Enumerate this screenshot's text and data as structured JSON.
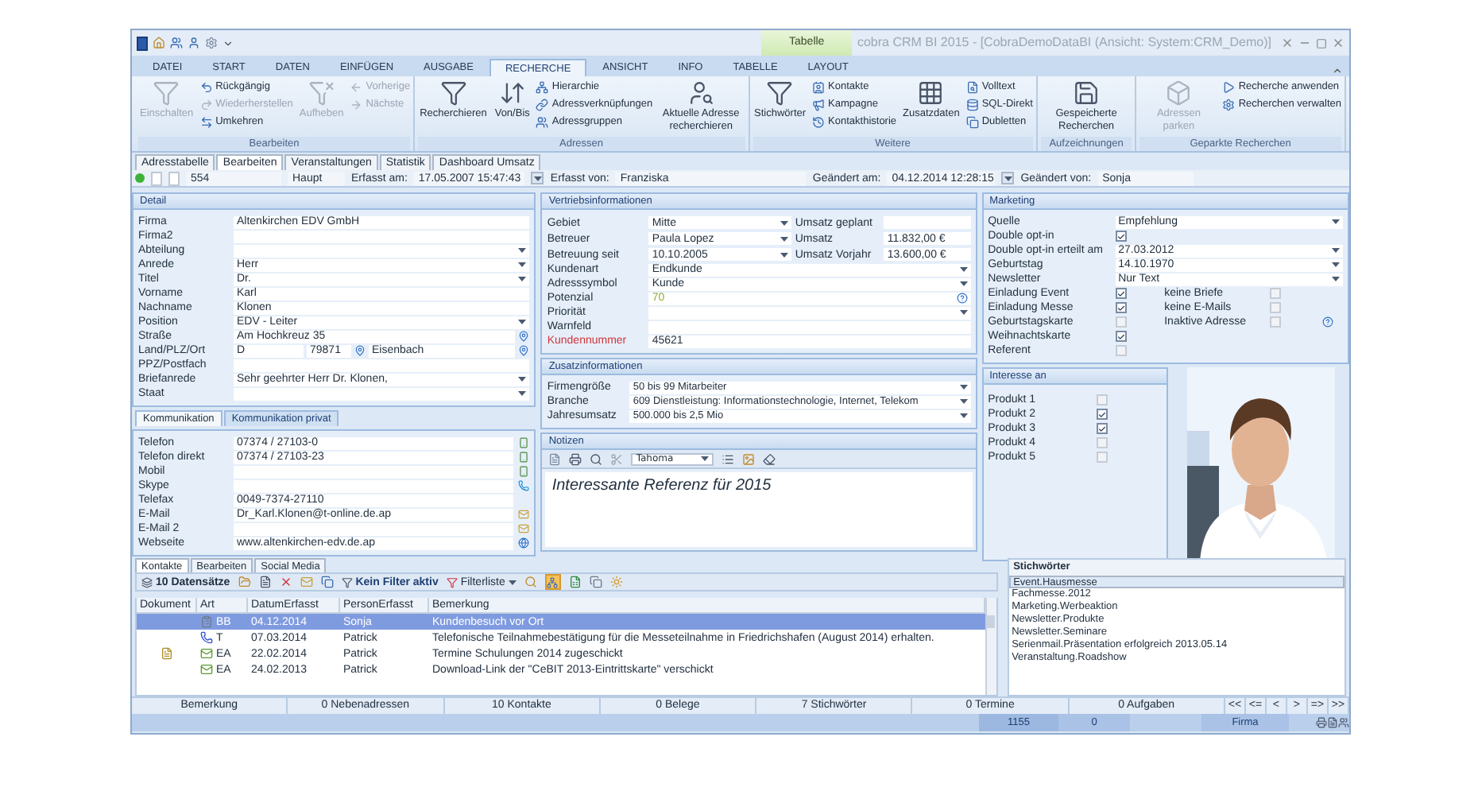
{
  "window": {
    "title": "cobra CRM BI 2015 - [CobraDemoDataBI (Ansicht: System:CRM_Demo)]",
    "context_tab": "Tabelle"
  },
  "ribbon_tabs": [
    {
      "label": "DATEI",
      "selected": false
    },
    {
      "label": "START",
      "selected": false
    },
    {
      "label": "DATEN",
      "selected": false
    },
    {
      "label": "EINFÜGEN",
      "selected": false
    },
    {
      "label": "AUSGABE",
      "selected": false
    },
    {
      "label": "RECHERCHE",
      "selected": true
    },
    {
      "label": "ANSICHT",
      "selected": false
    },
    {
      "label": "INFO",
      "selected": false
    },
    {
      "label": "TABELLE",
      "selected": false
    },
    {
      "label": "LAYOUT",
      "selected": false
    }
  ],
  "ribbon_groups": [
    {
      "title": "Bearbeiten",
      "columns": [
        {
          "kind": "large",
          "items": [
            {
              "label": "Einschalten",
              "disabled": true
            }
          ]
        },
        {
          "kind": "stack",
          "items": [
            {
              "label": "Rückgängig",
              "disabled": false
            },
            {
              "label": "Wiederherstellen",
              "disabled": true
            },
            {
              "label": "Umkehren",
              "disabled": false
            }
          ]
        },
        {
          "kind": "large",
          "items": [
            {
              "label": "Aufheben",
              "disabled": true
            }
          ]
        },
        {
          "kind": "stack",
          "items": [
            {
              "label": "Vorherige",
              "disabled": true
            },
            {
              "label": "Nächste",
              "disabled": true
            }
          ]
        }
      ]
    },
    {
      "title": "Adressen",
      "columns": [
        {
          "kind": "large",
          "items": [
            {
              "label": "Recherchieren",
              "disabled": false
            }
          ]
        },
        {
          "kind": "large",
          "items": [
            {
              "label": "Von/Bis",
              "disabled": false
            }
          ]
        },
        {
          "kind": "stack",
          "items": [
            {
              "label": "Hierarchie",
              "disabled": false
            },
            {
              "label": "Adressverknüpfungen",
              "disabled": false
            },
            {
              "label": "Adressgruppen",
              "disabled": false
            }
          ]
        },
        {
          "kind": "large",
          "items": [
            {
              "label": "Aktuelle Adresse recherchieren",
              "disabled": false
            }
          ]
        }
      ]
    },
    {
      "title": "Weitere",
      "columns": [
        {
          "kind": "large",
          "items": [
            {
              "label": "Stichwörter",
              "disabled": false
            }
          ]
        },
        {
          "kind": "stack",
          "items": [
            {
              "label": "Kontakte",
              "disabled": false
            },
            {
              "label": "Kampagne",
              "disabled": false
            },
            {
              "label": "Kontakthistorie",
              "disabled": false
            }
          ]
        },
        {
          "kind": "large",
          "items": [
            {
              "label": "Zusatzdaten",
              "disabled": false
            }
          ]
        },
        {
          "kind": "stack",
          "items": [
            {
              "label": "Volltext",
              "disabled": false
            },
            {
              "label": "SQL-Direkt",
              "disabled": false
            },
            {
              "label": "Dubletten",
              "disabled": false
            }
          ]
        }
      ]
    },
    {
      "title": "Aufzeichnungen",
      "columns": [
        {
          "kind": "large",
          "items": [
            {
              "label": "Gespeicherte Recherchen",
              "disabled": false
            }
          ]
        }
      ]
    },
    {
      "title": "Geparkte Recherchen",
      "columns": [
        {
          "kind": "large",
          "items": [
            {
              "label": "Adressen parken",
              "disabled": true
            }
          ]
        },
        {
          "kind": "stack",
          "items": [
            {
              "label": "Recherche anwenden",
              "disabled": false
            },
            {
              "label": "Recherchen verwalten",
              "disabled": false
            }
          ]
        }
      ]
    }
  ],
  "doc_tabs": [
    {
      "label": "Adresstabelle",
      "selected": false
    },
    {
      "label": "Bearbeiten",
      "selected": true
    },
    {
      "label": "Veranstaltungen",
      "selected": false
    },
    {
      "label": "Statistik",
      "selected": false
    },
    {
      "label": "Dashboard Umsatz",
      "selected": false
    }
  ],
  "record": {
    "id": "554",
    "type": "Haupt",
    "created_label": "Erfasst am:",
    "created": "17.05.2007 15:47:43",
    "creator_label": "Erfasst von:",
    "creator": "Franziska",
    "changed_label": "Geändert am:",
    "changed": "04.12.2014 12:28:15",
    "changer_label": "Geändert von:",
    "changer": "Sonja"
  },
  "detail": {
    "title": "Detail",
    "fields": [
      {
        "label": "Firma",
        "value": "Altenkirchen EDV GmbH",
        "kind": "text"
      },
      {
        "label": "Firma2",
        "kind": "text"
      },
      {
        "label": "Abteilung",
        "kind": "dropdown"
      },
      {
        "label": "Anrede",
        "value": "Herr",
        "kind": "dropdown"
      },
      {
        "label": "Titel",
        "value": "Dr.",
        "kind": "dropdown"
      },
      {
        "label": "Vorname",
        "value": "Karl",
        "kind": "text"
      },
      {
        "label": "Nachname",
        "value": "Klonen",
        "kind": "text"
      },
      {
        "label": "Position",
        "value": "EDV - Leiter",
        "kind": "dropdown"
      },
      {
        "label": "Straße",
        "value": "Am Hochkreuz 35",
        "kind": "pin"
      },
      {
        "label": "Land/PLZ/Ort",
        "value": "D",
        "postcode": "79871",
        "city": "Eisenbach",
        "kind": "address"
      },
      {
        "label": "PPZ/Postfach",
        "kind": "text"
      },
      {
        "label": "Briefanrede",
        "value": "Sehr geehrter Herr Dr. Klonen,",
        "kind": "dropdown"
      },
      {
        "label": "Staat",
        "kind": "dropdown"
      }
    ]
  },
  "comm_tabs": [
    {
      "label": "Kommunikation",
      "selected": true
    },
    {
      "label": "Kommunikation privat",
      "selected": false
    }
  ],
  "communication": [
    {
      "label": "Telefon",
      "value": "07374 / 27103-0",
      "kind": "phone"
    },
    {
      "label": "Telefon direkt",
      "value": "07374 / 27103-23",
      "kind": "phone"
    },
    {
      "label": "Mobil",
      "kind": "phone"
    },
    {
      "label": "Skype",
      "kind": "skype"
    },
    {
      "label": "Telefax",
      "value": "0049-7374-27110",
      "kind": "plain"
    },
    {
      "label": "E-Mail",
      "value": "Dr_Karl.Klonen@t-online.de.ap",
      "kind": "mail"
    },
    {
      "label": "E-Mail 2",
      "kind": "mail"
    },
    {
      "label": "Webseite",
      "value": "www.altenkirchen-edv.de.ap",
      "kind": "web"
    }
  ],
  "sales": {
    "title": "Vertriebsinformationen",
    "top_rows": [
      {
        "label": "Gebiet",
        "value": "Mitte",
        "side_label": "Umsatz geplant"
      },
      {
        "label": "Betreuer",
        "value": "Paula Lopez",
        "side_label": "Umsatz",
        "side_value": "11.832,00 €"
      },
      {
        "label": "Betreuung seit",
        "value": "10.10.2005",
        "side_label": "Umsatz Vorjahr",
        "side_value": "13.600,00 €"
      }
    ],
    "fields": [
      {
        "label": "Kundenart",
        "value": "Endkunde",
        "kind": "dropdown"
      },
      {
        "label": "Adresssymbol",
        "value": "Kunde",
        "kind": "dropdown"
      },
      {
        "label": "Potenzial",
        "value": "70",
        "kind": "help",
        "color": "#8fae3a"
      },
      {
        "label": "Priorität",
        "kind": "dropdown"
      },
      {
        "label": "Warnfeld",
        "kind": "text"
      },
      {
        "label": "Kundennummer",
        "value": "45621",
        "kind": "required"
      }
    ]
  },
  "extra": {
    "title": "Zusatzinformationen",
    "fields": [
      {
        "label": "Firmengröße",
        "value": "50 bis 99 Mitarbeiter"
      },
      {
        "label": "Branche",
        "value": "609 Dienstleistung: Informationstechnologie, Internet, Telekom"
      },
      {
        "label": "Jahresumsatz",
        "value": "500.000 bis 2,5 Mio"
      }
    ]
  },
  "notes": {
    "title": "Notizen",
    "font": "Tahoma",
    "text": "Interessante Referenz für 2015"
  },
  "marketing": {
    "title": "Marketing",
    "fields": [
      {
        "label": "Quelle",
        "value": "Empfehlung",
        "kind": "dropdown"
      },
      {
        "label": "Double opt-in",
        "kind": "checkbox",
        "checked": true
      },
      {
        "label": "Double opt-in erteilt am",
        "value": "27.03.2012",
        "kind": "dropdown"
      },
      {
        "label": "Geburtstag",
        "value": "14.10.1970",
        "kind": "dropdown"
      },
      {
        "label": "Newsletter",
        "value": "Nur Text",
        "kind": "dropdown"
      }
    ],
    "options_left": [
      {
        "label": "Einladung Event",
        "checked": true
      },
      {
        "label": "Einladung Messe",
        "checked": true
      },
      {
        "label": "Geburtstagskarte",
        "checked": false
      },
      {
        "label": "Weihnachtskarte",
        "checked": true
      },
      {
        "label": "Referent",
        "checked": false
      }
    ],
    "options_right": [
      {
        "label": "keine Briefe",
        "checked": false,
        "kind": "plain"
      },
      {
        "label": "keine E-Mails",
        "checked": false,
        "kind": "plain"
      },
      {
        "label": "Inaktive Adresse",
        "checked": false,
        "kind": "help"
      }
    ]
  },
  "interests": {
    "title": "Interesse an",
    "items": [
      {
        "label": "Produkt 1",
        "checked": false
      },
      {
        "label": "Produkt 2",
        "checked": true
      },
      {
        "label": "Produkt 3",
        "checked": true
      },
      {
        "label": "Produkt 4",
        "checked": false
      },
      {
        "label": "Produkt 5",
        "checked": false
      }
    ]
  },
  "photo": {
    "kind": "picture"
  },
  "bottom_tabs": [
    {
      "label": "Kontakte",
      "selected": true
    },
    {
      "label": "Bearbeiten",
      "selected": false
    },
    {
      "label": "Social Media",
      "selected": false
    }
  ],
  "contacts": {
    "count": "10 Datensätze",
    "filter": "Kein Filter aktiv",
    "filter_list": "Filterliste",
    "columns": [
      "Dokument",
      "Art",
      "DatumErfasst",
      "PersonErfasst",
      "Bemerkung"
    ],
    "rows": [
      {
        "document": false,
        "kind": "note",
        "art": "BB",
        "date": "04.12.2014",
        "person": "Sonja",
        "note": "Kundenbesuch vor Ort",
        "selected": true
      },
      {
        "document": false,
        "kind": "call",
        "art": "T",
        "date": "07.03.2014",
        "person": "Patrick",
        "note": "Telefonische Teilnahmebestätigung für die Messeteilnahme in Friedrichshafen (August 2014) erhalten.",
        "selected": false
      },
      {
        "document": true,
        "kind": "mail",
        "art": "EA",
        "date": "22.02.2014",
        "person": "Patrick",
        "note": "Termine Schulungen 2014 zugeschickt",
        "selected": false
      },
      {
        "document": false,
        "kind": "mail",
        "art": "EA",
        "date": "24.02.2013",
        "person": "Patrick",
        "note": "Download-Link der \"CeBIT 2013-Eintrittskarte\" verschickt",
        "selected": false
      }
    ]
  },
  "keywords": {
    "title": "Stichwörter",
    "items": [
      {
        "label": "Event.Hausmesse",
        "selected": true
      },
      {
        "label": "Fachmesse.2012",
        "selected": false
      },
      {
        "label": "Marketing.Werbeaktion",
        "selected": false
      },
      {
        "label": "Newsletter.Produkte",
        "selected": false
      },
      {
        "label": "Newsletter.Seminare",
        "selected": false
      },
      {
        "label": "Serienmail.Präsentation erfolgreich 2013.05.14",
        "selected": false
      },
      {
        "label": "Veranstaltung.Roadshow",
        "selected": false
      }
    ]
  },
  "counts": [
    "Bemerkung",
    "0 Nebenadressen",
    "10 Kontakte",
    "0 Belege",
    "7 Stichwörter",
    "0 Termine",
    "0 Aufgaben"
  ],
  "nav_buttons": [
    "<<",
    "<=",
    "<",
    ">",
    "=>",
    ">>"
  ],
  "status_bar": [
    "1155",
    "0",
    "Firma"
  ]
}
